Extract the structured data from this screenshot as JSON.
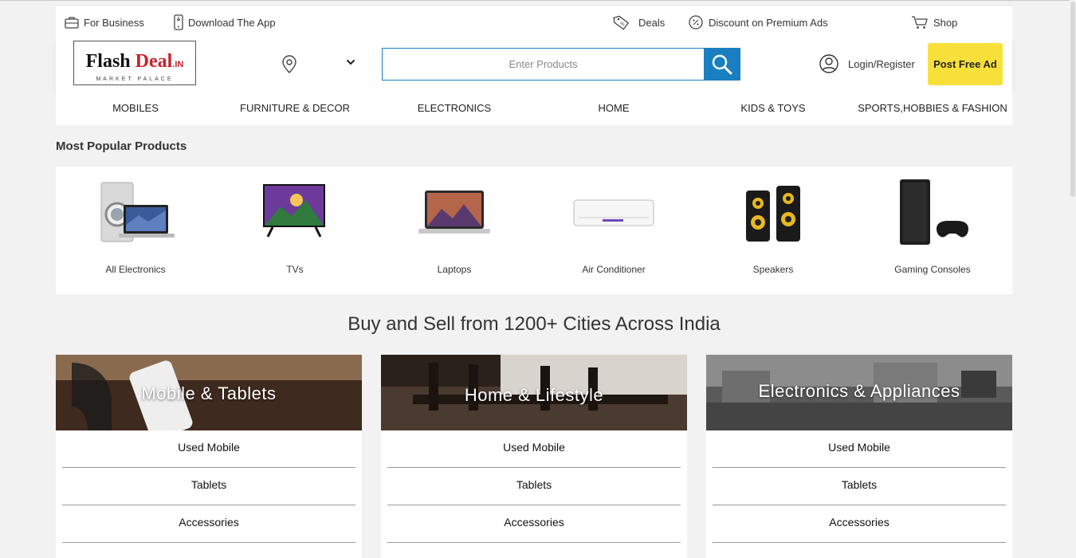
{
  "utility_bar": {
    "for_business": "For Business",
    "download_app": "Download The App",
    "deals": "Deals",
    "discount": "Discount on Premium Ads",
    "shop": "Shop"
  },
  "header": {
    "logo_flash": "Flash",
    "logo_deal": "Deal",
    "logo_tld": ".IN",
    "logo_sub": "MARKET PALACE",
    "search_placeholder": "Enter Products",
    "login": "Login/Register",
    "post_ad": "Post Free Ad"
  },
  "categories": [
    "MOBILES",
    "FURNITURE & DECOR",
    "ELECTRONICS",
    "HOME",
    "KIDS & TOYS",
    "SPORTS,HOBBIES & FASHION"
  ],
  "popular": {
    "title": "Most Popular Products",
    "items": [
      "All Electronics",
      "TVs",
      "Laptops",
      "Air Conditioner",
      "Speakers",
      "Gaming Consoles"
    ]
  },
  "headline": "Buy and Sell from 1200+ Cities Across India",
  "tiles": [
    {
      "title": "Mobile & Tablets",
      "links": [
        "Used Mobile",
        "Tablets",
        "Accessories"
      ]
    },
    {
      "title": "Home & Lifestyle",
      "links": [
        "Used Mobile",
        "Tablets",
        "Accessories"
      ]
    },
    {
      "title": "Electronics & Appliances",
      "links": [
        "Used Mobile",
        "Tablets",
        "Accessories"
      ]
    }
  ],
  "colors": {
    "accent_blue": "#1a7fc0",
    "cta_yellow": "#f8e03a",
    "logo_red": "#c7232b"
  }
}
